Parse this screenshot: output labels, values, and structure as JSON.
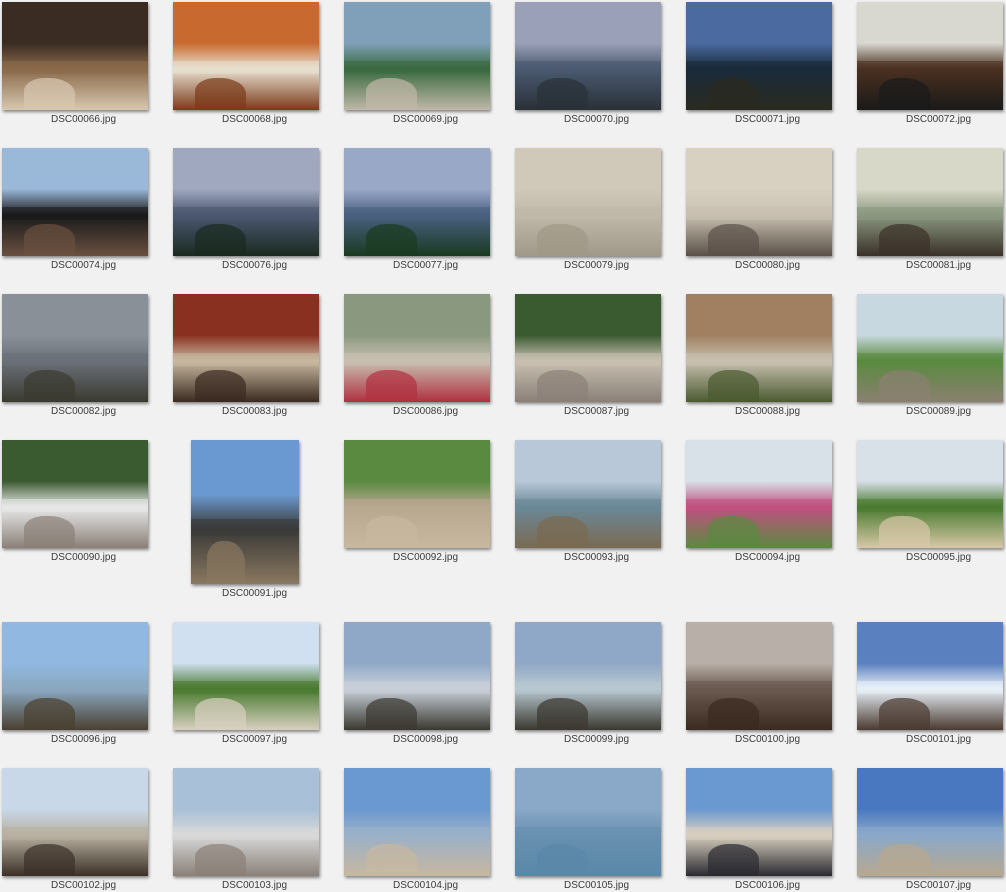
{
  "gallery": {
    "items": [
      {
        "filename": "DSC00066.jpg",
        "scene": "interior-people",
        "palette": [
          "#3a2c22",
          "#8a6a4a",
          "#d8c8b0"
        ]
      },
      {
        "filename": "DSC00068.jpg",
        "scene": "interior-cabinet",
        "palette": [
          "#c86a30",
          "#e8e0d0",
          "#7a3a1a"
        ]
      },
      {
        "filename": "DSC00069.jpg",
        "scene": "aerial-resort",
        "palette": [
          "#7fa0b8",
          "#3a6a40",
          "#c0b8a8"
        ]
      },
      {
        "filename": "DSC00070.jpg",
        "scene": "seascape-rocks",
        "palette": [
          "#9aa0b8",
          "#4a5a70",
          "#2a3038"
        ]
      },
      {
        "filename": "DSC00071.jpg",
        "scene": "seascape-trees",
        "palette": [
          "#4a6aa0",
          "#1a2a3a",
          "#2a2a20"
        ]
      },
      {
        "filename": "DSC00072.jpg",
        "scene": "interior-room",
        "palette": [
          "#d8d8d0",
          "#4a3020",
          "#1a1a1a"
        ]
      },
      {
        "filename": "DSC00074.jpg",
        "scene": "window-view",
        "palette": [
          "#9ab8d8",
          "#1a1a1a",
          "#6a5040"
        ]
      },
      {
        "filename": "DSC00076.jpg",
        "scene": "seascape-rocks",
        "palette": [
          "#a0a8c0",
          "#4a5870",
          "#1a2a20"
        ]
      },
      {
        "filename": "DSC00077.jpg",
        "scene": "seascape-palms",
        "palette": [
          "#9aa8c8",
          "#4a6080",
          "#1a3a20"
        ]
      },
      {
        "filename": "DSC00079.jpg",
        "scene": "beach-sand",
        "palette": [
          "#d0c8b8",
          "#c0b8a8",
          "#a09888"
        ]
      },
      {
        "filename": "DSC00080.jpg",
        "scene": "beach-sand",
        "palette": [
          "#d8d0c0",
          "#c8c0b0",
          "#5a5048"
        ]
      },
      {
        "filename": "DSC00081.jpg",
        "scene": "interior-livingroom",
        "palette": [
          "#d8d8c8",
          "#8a9880",
          "#3a3028"
        ]
      },
      {
        "filename": "DSC00082.jpg",
        "scene": "seascape-rocks",
        "palette": [
          "#8a9098",
          "#6a7078",
          "#3a3a30"
        ]
      },
      {
        "filename": "DSC00083.jpg",
        "scene": "interior-people",
        "palette": [
          "#8a3020",
          "#c8b8a0",
          "#3a2a20"
        ]
      },
      {
        "filename": "DSC00086.jpg",
        "scene": "street-couple",
        "palette": [
          "#8a9880",
          "#c8c0b0",
          "#b03040"
        ]
      },
      {
        "filename": "DSC00087.jpg",
        "scene": "street-group",
        "palette": [
          "#3a5a30",
          "#c8c0b0",
          "#8a8078"
        ]
      },
      {
        "filename": "DSC00088.jpg",
        "scene": "street-group",
        "palette": [
          "#a08060",
          "#c8c0b0",
          "#4a5a30"
        ]
      },
      {
        "filename": "DSC00089.jpg",
        "scene": "greenery-wall",
        "palette": [
          "#c8d8e0",
          "#5a8a40",
          "#8a8070"
        ]
      },
      {
        "filename": "DSC00090.jpg",
        "scene": "street-truck",
        "palette": [
          "#3a5a30",
          "#e8e8e8",
          "#8a8078"
        ]
      },
      {
        "filename": "DSC00091.jpg",
        "scene": "building-sky",
        "portrait": true,
        "palette": [
          "#6a98d0",
          "#3a3a38",
          "#8a7860"
        ]
      },
      {
        "filename": "DSC00092.jpg",
        "scene": "path-person",
        "palette": [
          "#5a8a40",
          "#b8a890",
          "#c8b8a0"
        ]
      },
      {
        "filename": "DSC00093.jpg",
        "scene": "seascape-rocks",
        "palette": [
          "#b8c8d8",
          "#6a8898",
          "#7a6a50"
        ]
      },
      {
        "filename": "DSC00094.jpg",
        "scene": "garden-flowers",
        "palette": [
          "#d8e0e8",
          "#c05080",
          "#5a8a40"
        ]
      },
      {
        "filename": "DSC00095.jpg",
        "scene": "beach-walk",
        "palette": [
          "#d8e0e8",
          "#4a7a30",
          "#d8c8a8"
        ]
      },
      {
        "filename": "DSC00096.jpg",
        "scene": "coast-hills",
        "palette": [
          "#90b8e0",
          "#8aa8c0",
          "#4a4030"
        ]
      },
      {
        "filename": "DSC00097.jpg",
        "scene": "beach-houses",
        "palette": [
          "#d0e0f0",
          "#4a7a30",
          "#d8d0c0"
        ]
      },
      {
        "filename": "DSC00098.jpg",
        "scene": "coast-rocks",
        "palette": [
          "#90a8c8",
          "#c8d0d8",
          "#3a3830"
        ]
      },
      {
        "filename": "DSC00099.jpg",
        "scene": "coast-rocks",
        "palette": [
          "#90a8c8",
          "#b8c8d0",
          "#3a3830"
        ]
      },
      {
        "filename": "DSC00100.jpg",
        "scene": "beach-rocks",
        "palette": [
          "#b8b0a8",
          "#6a5a50",
          "#3a2a20"
        ]
      },
      {
        "filename": "DSC00101.jpg",
        "scene": "waves-rocks",
        "palette": [
          "#5a80c0",
          "#e8f0f8",
          "#4a3a30"
        ]
      },
      {
        "filename": "DSC00102.jpg",
        "scene": "beach-town",
        "palette": [
          "#c8d8e8",
          "#b8b0a0",
          "#3a3028"
        ]
      },
      {
        "filename": "DSC00103.jpg",
        "scene": "beach-waves",
        "palette": [
          "#a8c0d8",
          "#d8d8d8",
          "#8a8078"
        ]
      },
      {
        "filename": "DSC00104.jpg",
        "scene": "beach-couple",
        "palette": [
          "#6a98d0",
          "#9ab0c8",
          "#c8b8a0"
        ]
      },
      {
        "filename": "DSC00105.jpg",
        "scene": "open-sea",
        "palette": [
          "#8aa8c8",
          "#6890b0",
          "#5a88a8"
        ]
      },
      {
        "filename": "DSC00106.jpg",
        "scene": "beach-group",
        "palette": [
          "#6a98d0",
          "#d8d0c0",
          "#2a2a30"
        ]
      },
      {
        "filename": "DSC00107.jpg",
        "scene": "beach-shore",
        "palette": [
          "#4a78c0",
          "#8aa8c8",
          "#b8a890"
        ]
      }
    ]
  }
}
